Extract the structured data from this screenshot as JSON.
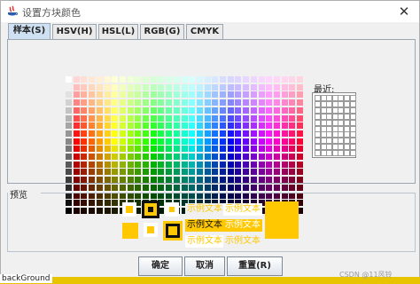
{
  "window": {
    "title": "设置方块颜色",
    "close_glyph": "✕"
  },
  "tabs": [
    {
      "label": "样本(S)",
      "active": true
    },
    {
      "label": "HSV(H)"
    },
    {
      "label": "HSL(L)"
    },
    {
      "label": "RGB(G)"
    },
    {
      "label": "CMYK"
    }
  ],
  "recent": {
    "label": "最近:"
  },
  "preview": {
    "label": "预览",
    "sample_text": "示例文本",
    "selected_color": "#FFC800"
  },
  "buttons": {
    "ok": "确定",
    "cancel": "取消",
    "reset": "重置(R)"
  },
  "background_text": "backGround",
  "watermark": "CSDN @11风铃"
}
